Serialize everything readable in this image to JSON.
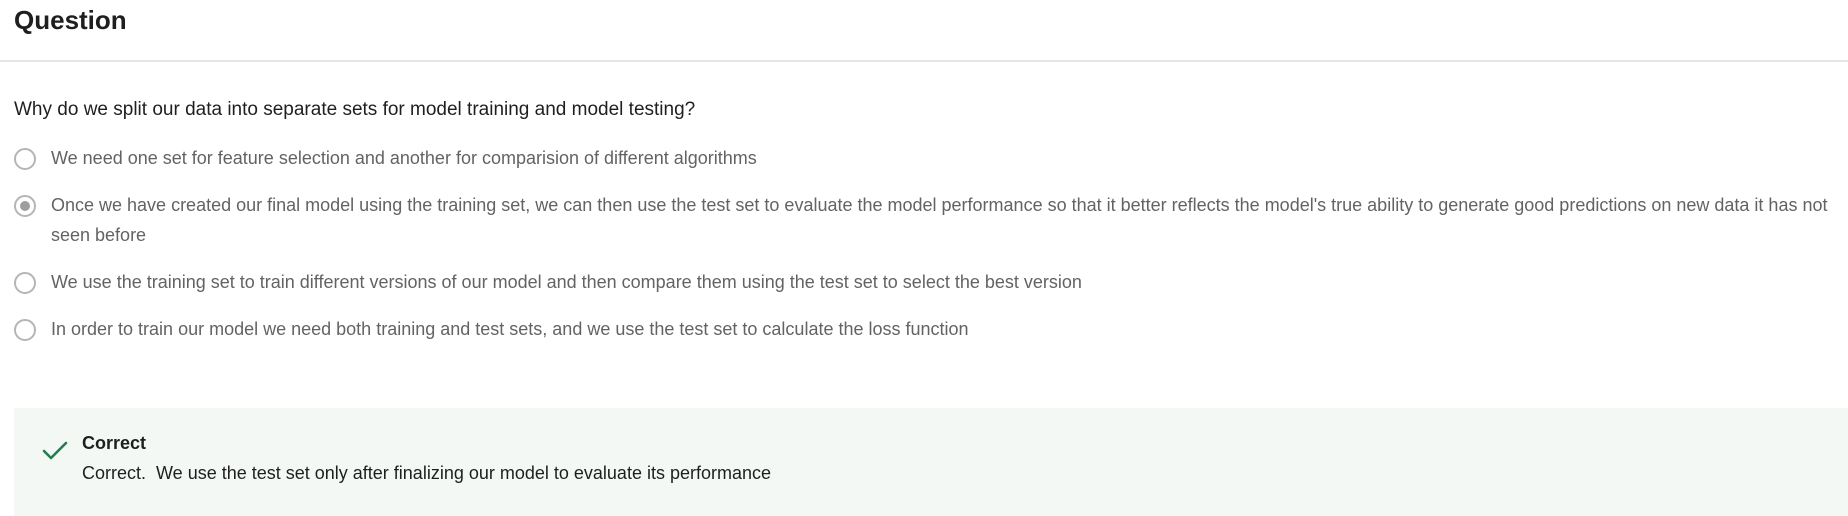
{
  "header": {
    "title": "Question"
  },
  "question": {
    "text": "Why do we split our data into separate sets for model training and model testing?",
    "options": [
      {
        "label": "We need one set for feature selection and another for comparision of different algorithms",
        "selected": false
      },
      {
        "label": "Once we have created our final model using the training set, we can then use the test set to evaluate the model performance so that it better reflects the model's true ability to generate good predictions on new data it has not seen before",
        "selected": true
      },
      {
        "label": "We use the training set to train different versions of our model and then compare them using the test set to select the best version",
        "selected": false
      },
      {
        "label": "In order to train our model we need both training and test sets, and we use the test set to calculate the loss function",
        "selected": false
      }
    ]
  },
  "feedback": {
    "icon": "check-icon",
    "title": "Correct",
    "text": "Correct.  We use the test set only after finalizing our model to evaluate its performance",
    "accent_color": "#1e7f4f",
    "background_color": "#f4f8f5"
  }
}
